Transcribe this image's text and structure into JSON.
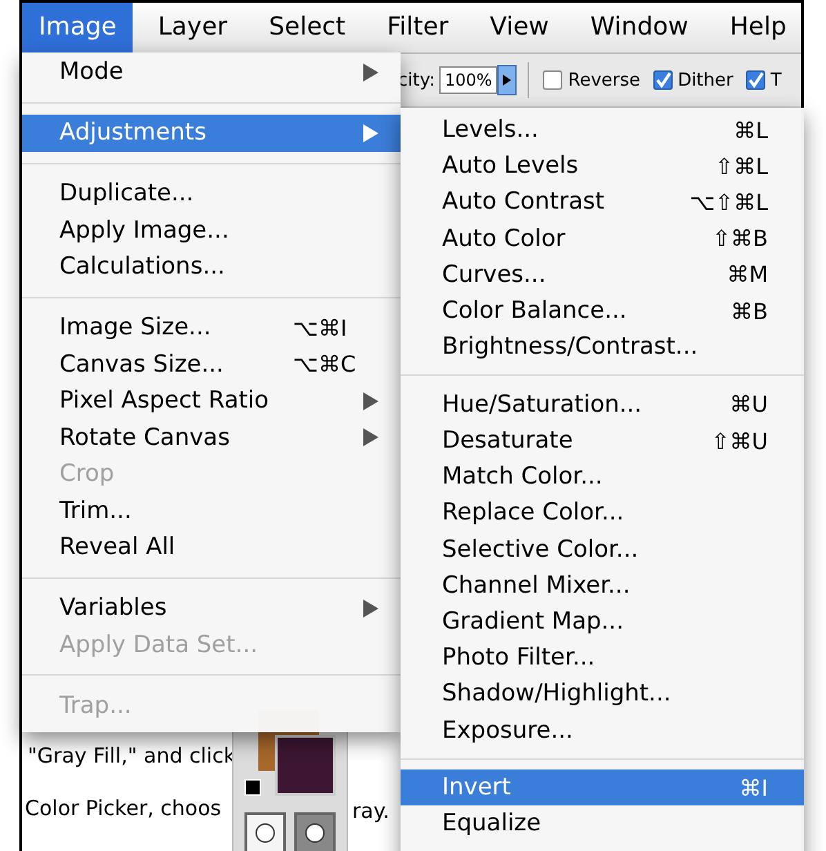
{
  "menu_bar": [
    {
      "label": "Image",
      "selected": true
    },
    {
      "label": "Layer",
      "selected": false
    },
    {
      "label": "Select",
      "selected": false
    },
    {
      "label": "Filter",
      "selected": false
    },
    {
      "label": "View",
      "selected": false
    },
    {
      "label": "Window",
      "selected": false
    },
    {
      "label": "Help",
      "selected": false
    }
  ],
  "toolbar": {
    "opacity_label": "city:",
    "opacity_value": "100%",
    "options": [
      {
        "label": "Reverse",
        "checked": false
      },
      {
        "label": "Dither",
        "checked": true
      },
      {
        "label": "T",
        "checked": true
      }
    ]
  },
  "image_menu": {
    "groups": [
      [
        {
          "label": "Mode",
          "submenu": true,
          "disabled": false,
          "selected": false
        }
      ],
      [
        {
          "label": "Adjustments",
          "submenu": true,
          "disabled": false,
          "selected": true
        }
      ],
      [
        {
          "label": "Duplicate...",
          "submenu": false,
          "disabled": false,
          "selected": false
        },
        {
          "label": "Apply Image...",
          "submenu": false,
          "disabled": false,
          "selected": false
        },
        {
          "label": "Calculations...",
          "submenu": false,
          "disabled": false,
          "selected": false
        }
      ],
      [
        {
          "label": "Image Size...",
          "shortcut": "⌥⌘I",
          "submenu": false,
          "disabled": false,
          "selected": false
        },
        {
          "label": "Canvas Size...",
          "shortcut": "⌥⌘C",
          "submenu": false,
          "disabled": false,
          "selected": false
        },
        {
          "label": "Pixel Aspect Ratio",
          "submenu": true,
          "disabled": false,
          "selected": false
        },
        {
          "label": "Rotate Canvas",
          "submenu": true,
          "disabled": false,
          "selected": false
        },
        {
          "label": "Crop",
          "submenu": false,
          "disabled": true,
          "selected": false
        },
        {
          "label": "Trim...",
          "submenu": false,
          "disabled": false,
          "selected": false
        },
        {
          "label": "Reveal All",
          "submenu": false,
          "disabled": false,
          "selected": false
        }
      ],
      [
        {
          "label": "Variables",
          "submenu": true,
          "disabled": false,
          "selected": false
        },
        {
          "label": "Apply Data Set...",
          "submenu": false,
          "disabled": true,
          "selected": false
        }
      ],
      [
        {
          "label": "Trap...",
          "submenu": false,
          "disabled": true,
          "selected": false
        }
      ]
    ]
  },
  "adjustments_submenu": {
    "groups": [
      [
        {
          "label": "Levels...",
          "shortcut": "⌘L",
          "disabled": false,
          "selected": false
        },
        {
          "label": "Auto Levels",
          "shortcut": "⇧⌘L",
          "disabled": false,
          "selected": false
        },
        {
          "label": "Auto Contrast",
          "shortcut": "⌥⇧⌘L",
          "disabled": false,
          "selected": false
        },
        {
          "label": "Auto Color",
          "shortcut": "⇧⌘B",
          "disabled": false,
          "selected": false
        },
        {
          "label": "Curves...",
          "shortcut": "⌘M",
          "disabled": false,
          "selected": false
        },
        {
          "label": "Color Balance...",
          "shortcut": "⌘B",
          "disabled": false,
          "selected": false
        },
        {
          "label": "Brightness/Contrast...",
          "disabled": false,
          "selected": false
        }
      ],
      [
        {
          "label": "Hue/Saturation...",
          "shortcut": "⌘U",
          "disabled": false,
          "selected": false
        },
        {
          "label": "Desaturate",
          "shortcut": "⇧⌘U",
          "disabled": false,
          "selected": false
        },
        {
          "label": "Match Color...",
          "disabled": false,
          "selected": false
        },
        {
          "label": "Replace Color...",
          "disabled": false,
          "selected": false
        },
        {
          "label": "Selective Color...",
          "disabled": false,
          "selected": false
        },
        {
          "label": "Channel Mixer...",
          "disabled": false,
          "selected": false
        },
        {
          "label": "Gradient Map...",
          "disabled": false,
          "selected": false
        },
        {
          "label": "Photo Filter...",
          "disabled": false,
          "selected": false
        },
        {
          "label": "Shadow/Highlight...",
          "disabled": false,
          "selected": false
        },
        {
          "label": "Exposure...",
          "disabled": false,
          "selected": false
        }
      ],
      [
        {
          "label": "Invert",
          "shortcut": "⌘I",
          "disabled": false,
          "selected": true
        },
        {
          "label": "Equalize",
          "disabled": false,
          "selected": false
        }
      ]
    ]
  },
  "background_text": {
    "line_1": "\"Gray Fill,\" and click",
    "line_2": "Color Picker, choos",
    "line_3": "ray."
  }
}
